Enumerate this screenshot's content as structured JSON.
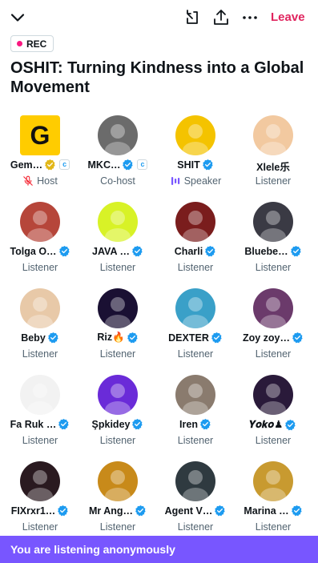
{
  "header": {
    "leave_label": "Leave"
  },
  "rec_label": "REC",
  "title": "OSHIT: Turning Kindness into a Global Movement",
  "participants": [
    {
      "name": "Gem…",
      "role": "Host",
      "verified": "gold",
      "extra_badge": "c",
      "role_icon": "muted-mic-icon",
      "avatar_color": "#ffcc00"
    },
    {
      "name": "MKC…",
      "role": "Co-host",
      "verified": "blue",
      "extra_badge": "c",
      "avatar_color": "#6b6b6b"
    },
    {
      "name": "SHIT",
      "role": "Speaker",
      "verified": "blue",
      "role_icon": "speaker-bars-icon",
      "avatar_color": "#f4c300"
    },
    {
      "name": "Xlele乐",
      "role": "Listener",
      "verified": "none",
      "avatar_color": "#f2c9a0"
    },
    {
      "name": "Tolga O…",
      "role": "Listener",
      "verified": "blue",
      "avatar_color": "#b6463a"
    },
    {
      "name": "JAVA …",
      "role": "Listener",
      "verified": "blue",
      "avatar_color": "#d8f227"
    },
    {
      "name": "Charli",
      "role": "Listener",
      "verified": "blue",
      "avatar_color": "#7a1d1d"
    },
    {
      "name": "Bluebe…",
      "role": "Listener",
      "verified": "blue",
      "avatar_color": "#3a3a44"
    },
    {
      "name": "Beby",
      "role": "Listener",
      "verified": "blue",
      "avatar_color": "#e8c9a8"
    },
    {
      "name": "Riz🔥",
      "role": "Listener",
      "verified": "blue",
      "avatar_color": "#1a1033"
    },
    {
      "name": "DEXTER",
      "role": "Listener",
      "verified": "blue",
      "avatar_color": "#3aa0c8"
    },
    {
      "name": "Zoy zoy…",
      "role": "Listener",
      "verified": "blue",
      "avatar_color": "#6b3a6b"
    },
    {
      "name": "Fa Ruk …",
      "role": "Listener",
      "verified": "blue",
      "avatar_color": "#f2f2f2"
    },
    {
      "name": "Şpkidey",
      "role": "Listener",
      "verified": "blue",
      "avatar_color": "#6a2bd8"
    },
    {
      "name": "Iren",
      "role": "Listener",
      "verified": "blue",
      "avatar_color": "#8a7b6e"
    },
    {
      "name": "𝒀𝒐𝒌𝒐♟",
      "role": "Listener",
      "verified": "blue",
      "avatar_color": "#2a1a3a"
    },
    {
      "name": "FIXrxr1…",
      "role": "Listener",
      "verified": "blue",
      "avatar_color": "#2a1a20"
    },
    {
      "name": "Mr Ang…",
      "role": "Listener",
      "verified": "blue",
      "avatar_color": "#c88a1a"
    },
    {
      "name": "Agent V…",
      "role": "Listener",
      "verified": "blue",
      "avatar_color": "#2f3a40"
    },
    {
      "name": "Marina …",
      "role": "Listener",
      "verified": "blue",
      "avatar_color": "#c89a30"
    }
  ],
  "footer": {
    "text": "You are listening anonymously"
  },
  "colors": {
    "leave": "#e0245e",
    "verified_blue": "#1d9bf0",
    "verified_gold": "#e2b719",
    "footer_bg": "#7856ff",
    "speaker": "#7856ff",
    "rec_dot": "#f91880"
  }
}
